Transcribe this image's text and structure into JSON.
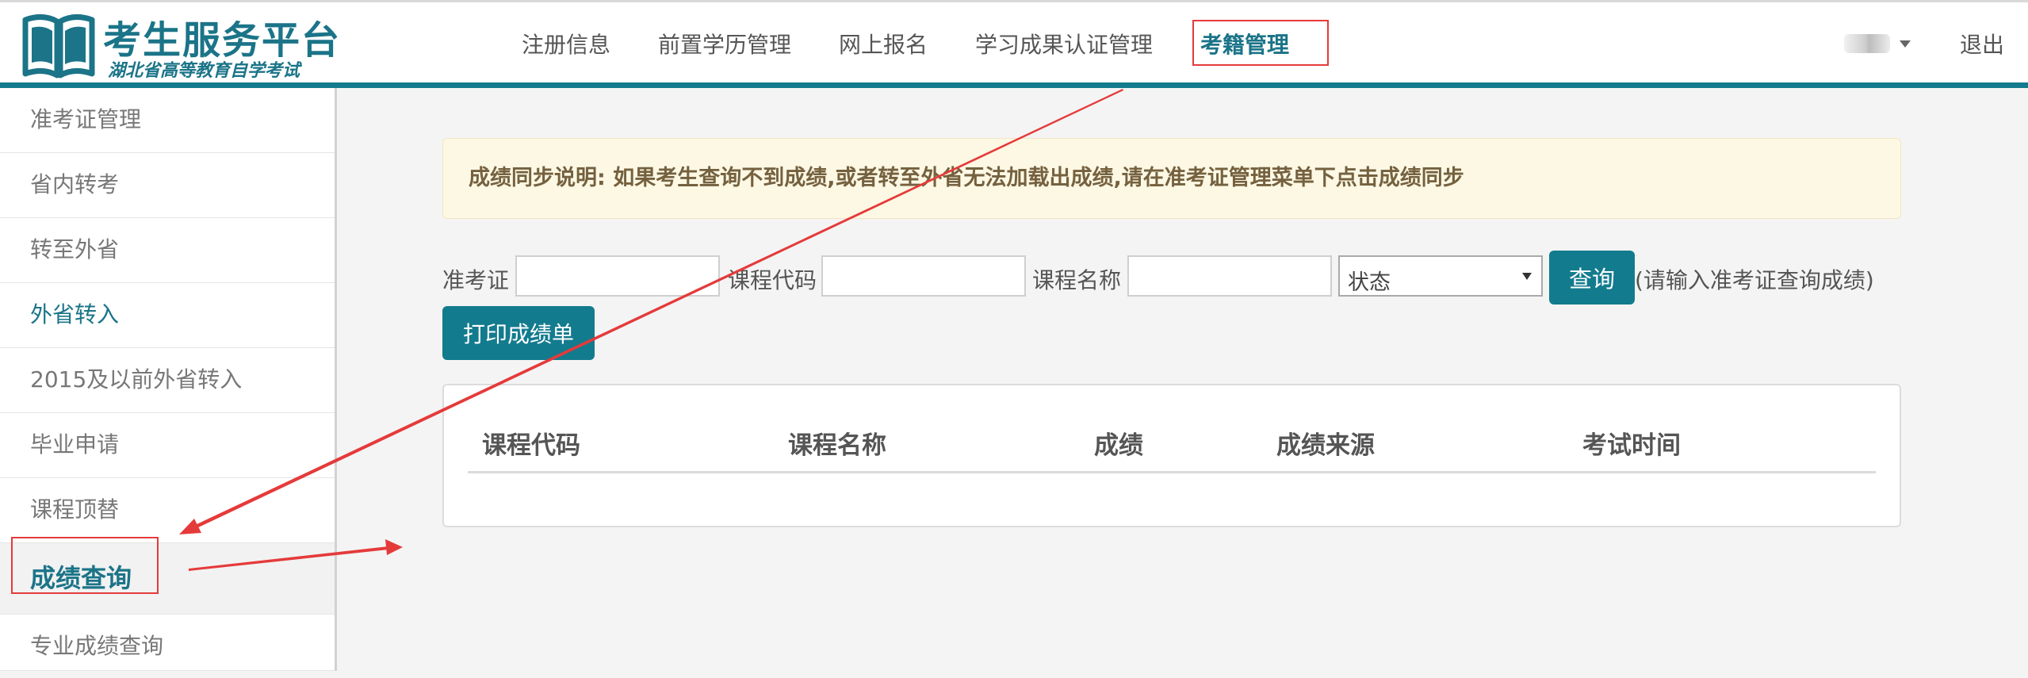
{
  "app": {
    "title": "考生服务平台",
    "subtitle": "湖北省高等教育自学考试"
  },
  "topnav": {
    "items": [
      {
        "label": "注册信息"
      },
      {
        "label": "前置学历管理"
      },
      {
        "label": "网上报名"
      },
      {
        "label": "学习成果认证管理"
      },
      {
        "label": "考籍管理"
      }
    ],
    "logout": "退出"
  },
  "sidebar": {
    "items": [
      {
        "label": "准考证管理"
      },
      {
        "label": "省内转考"
      },
      {
        "label": "转至外省"
      },
      {
        "label": "外省转入"
      },
      {
        "label": "2015及以前外省转入"
      },
      {
        "label": "毕业申请"
      },
      {
        "label": "课程顶替"
      },
      {
        "label": "成绩查询"
      },
      {
        "label": "专业成绩查询"
      }
    ]
  },
  "main": {
    "notice": "成绩同步说明: 如果考生查询不到成绩,或者转至外省无法加载出成绩,请在准考证管理菜单下点击成绩同步",
    "form": {
      "admission_label": "准考证",
      "admission_value": "",
      "course_code_label": "课程代码",
      "course_code_value": "",
      "course_name_label": "课程名称",
      "course_name_value": "",
      "status_selected": "状态",
      "query_button": "查询",
      "query_hint": "(请输入准考证查询成绩)",
      "print_button": "打印成绩单"
    },
    "table": {
      "columns": [
        "课程代码",
        "课程名称",
        "成绩",
        "成绩来源",
        "考试时间"
      ]
    }
  },
  "colors": {
    "accent": "#137b8e",
    "annotation": "#e53a3a",
    "notice_bg": "#fcf8e4"
  }
}
